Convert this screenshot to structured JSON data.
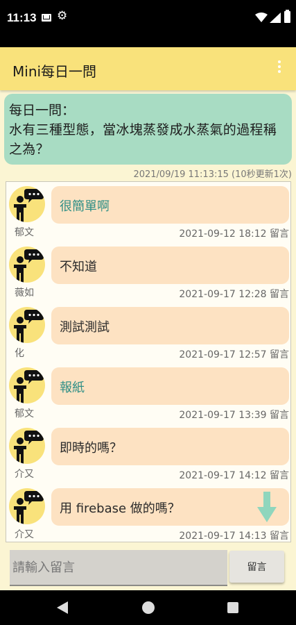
{
  "status_bar": {
    "time": "11:13",
    "icons": [
      "mail-icon",
      "gear-icon",
      "wifi-icon",
      "signal-icon",
      "battery-icon"
    ]
  },
  "app_bar": {
    "title": "Mini每日一問",
    "menu_icon": "overflow-menu-icon",
    "color": "#f9e27b"
  },
  "question": {
    "heading": "每日一問：",
    "text": "水有三種型態，當冰塊蒸發成水蒸氣的過程稱之為？",
    "timestamp": "2021/09/19 11:13:15 (10秒更新1次)",
    "color": "#a8dcc3"
  },
  "comments": [
    {
      "author": "郁文",
      "text": "很簡單啊",
      "meta": "2021-09-12 18:12 留言",
      "text_color": "#2f8f86"
    },
    {
      "author": "薇如",
      "text": "不知道",
      "meta": "2021-09-17 12:28 留言",
      "text_color": "#2a2a2a"
    },
    {
      "author": "化",
      "text": "測試測試",
      "meta": "2021-09-17 12:57 留言",
      "text_color": "#2a2a2a"
    },
    {
      "author": "郁文",
      "text": "報紙",
      "meta": "2021-09-17 13:39 留言",
      "text_color": "#2f8f86"
    },
    {
      "author": "介又",
      "text": "即時的嗎？",
      "meta": "2021-09-17 14:12 留言",
      "text_color": "#2a2a2a"
    },
    {
      "author": "介又",
      "text": "用 firebase 做的嗎？",
      "meta": "2021-09-17 14:13 留言",
      "text_color": "#2a2a2a"
    }
  ],
  "input": {
    "placeholder": "請輸入留言",
    "send_label": "留言"
  },
  "nav": {
    "icons": [
      "back-icon",
      "home-icon",
      "recents-icon"
    ]
  },
  "colors": {
    "bubble": "#fde2c2",
    "background": "#fbf5d3",
    "scroll_arrow": "#8fd6bd"
  }
}
